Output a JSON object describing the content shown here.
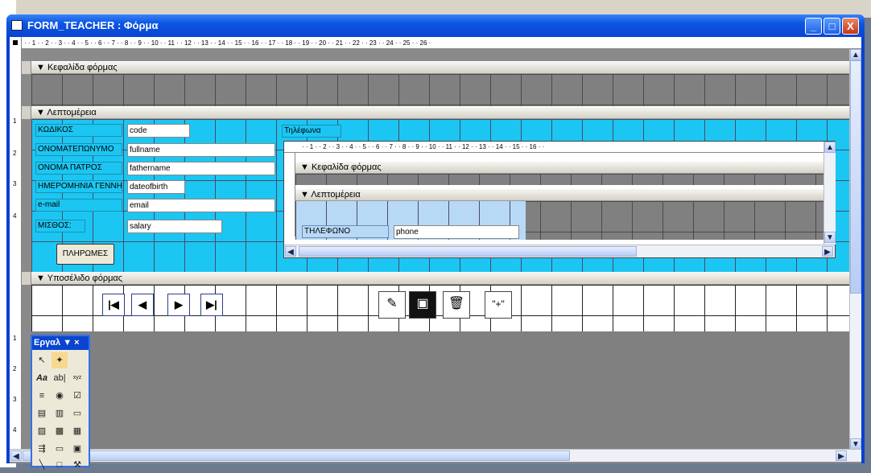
{
  "window": {
    "title": "FORM_TEACHER : Φόρμα",
    "minimize": "_",
    "maximize": "□",
    "close": "X"
  },
  "ruler": {
    "h_marks": "· · 1 · · 2 · · 3 · · 4 · · 5 · · 6 · · 7 · · 8 · · 9 · · 10 · · 11 · · 12 · · 13 · · 14 · · 15 · · 16 · · 17 · · 18 · · 19 · · 20 · · 21 · · 22 · · 23 · · 24 · · 25 · · 26 ·",
    "v_marks": [
      "1",
      "2",
      "3",
      "4",
      "1",
      "2",
      "3",
      "4"
    ]
  },
  "sections": {
    "header": "Κεφαλίδα φόρμας",
    "detail": "Λεπτομέρεια",
    "footer": "Υποσέλιδο φόρμας"
  },
  "fields": [
    {
      "label": "ΚΩΔΙΚΟΣ",
      "value": "code"
    },
    {
      "label": "ΟΝΟΜΑΤΕΠΩΝΥΜΟ",
      "value": "fullname"
    },
    {
      "label": "ΟΝΟΜΑ ΠΑΤΡΟΣ",
      "value": "fathername"
    },
    {
      "label": "ΗΜΕΡΟΜΗΝΙΑ ΓΕΝΝΗ",
      "value": "dateofbirth"
    },
    {
      "label": "e-mail",
      "value": "email"
    },
    {
      "label": "ΜΙΣΘΟΣ:",
      "value": "salary"
    }
  ],
  "payments_button": "ΠΛΗΡΩΜΕΣ",
  "subform": {
    "label": "Τηλέφωνα",
    "ruler": "· · 1 · · 2 · · 3 · · 4 · · 5 · · 6 · · 7 · · 8 · · 9 · · 10 · · 11 · · 12 · · 13 · · 14 · · 15 · · 16 · ·",
    "header": "Κεφαλίδα φόρμας",
    "detail": "Λεπτομέρεια",
    "field_label": "ΤΗΛΕΦΩΝΟ",
    "field_value": "phone"
  },
  "nav_buttons": [
    "|◀",
    "◀",
    "▶",
    "▶|"
  ],
  "action_buttons": [
    "edit",
    "save",
    "delete",
    "add"
  ],
  "add_label": "\"+\"",
  "toolbox": {
    "title": "Εργαλ ▼ ×",
    "tools": [
      "arrow",
      "wizard",
      "Aa",
      "ab|",
      "xyz",
      "toggle",
      "option",
      "checkbox",
      "combo",
      "list",
      "button",
      "image",
      "unbound",
      "bound",
      "pagebreak",
      "tab",
      "subform",
      "line",
      "rectangle",
      "more"
    ]
  }
}
